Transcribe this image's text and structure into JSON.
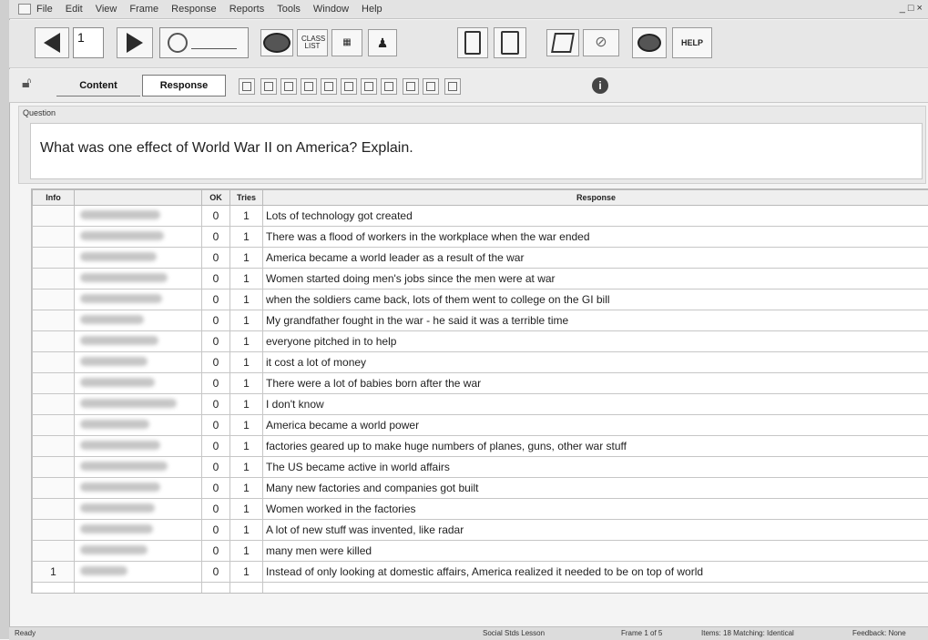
{
  "menu": {
    "items": [
      "File",
      "Edit",
      "View",
      "Frame",
      "Response",
      "Reports",
      "Tools",
      "Window",
      "Help"
    ]
  },
  "toolbar": {
    "page_number": "1",
    "class_list_label": "CLASS LIST",
    "help_label": "HELP"
  },
  "tabs": {
    "content_label": "Content",
    "response_label": "Response"
  },
  "question": {
    "label": "Question",
    "text": "What was one effect of World War II on America? Explain."
  },
  "table": {
    "headers": {
      "info": "Info",
      "name": "",
      "ok": "OK",
      "tries": "Tries",
      "response": "Response"
    },
    "rows": [
      {
        "info": "",
        "ok": "0",
        "tries": "1",
        "response": "Lots of technology got created"
      },
      {
        "info": "",
        "ok": "0",
        "tries": "1",
        "response": "There was a flood of workers in the workplace when the war ended"
      },
      {
        "info": "",
        "ok": "0",
        "tries": "1",
        "response": "America became a world leader as a result of the war"
      },
      {
        "info": "",
        "ok": "0",
        "tries": "1",
        "response": "Women started doing men's jobs since the men were at war"
      },
      {
        "info": "",
        "ok": "0",
        "tries": "1",
        "response": "when the soldiers came back, lots of them went to college on the GI bill"
      },
      {
        "info": "",
        "ok": "0",
        "tries": "1",
        "response": "My grandfather fought in the war - he said it was a terrible time"
      },
      {
        "info": "",
        "ok": "0",
        "tries": "1",
        "response": "everyone pitched in to help"
      },
      {
        "info": "",
        "ok": "0",
        "tries": "1",
        "response": "it cost a lot of money"
      },
      {
        "info": "",
        "ok": "0",
        "tries": "1",
        "response": "There were a lot of babies born after the war"
      },
      {
        "info": "",
        "ok": "0",
        "tries": "1",
        "response": "I don't know"
      },
      {
        "info": "",
        "ok": "0",
        "tries": "1",
        "response": "America became a world power"
      },
      {
        "info": "",
        "ok": "0",
        "tries": "1",
        "response": "factories geared up to make huge numbers of planes, guns, other war stuff"
      },
      {
        "info": "",
        "ok": "0",
        "tries": "1",
        "response": "The US became active in world affairs"
      },
      {
        "info": "",
        "ok": "0",
        "tries": "1",
        "response": "Many new factories and companies got built"
      },
      {
        "info": "",
        "ok": "0",
        "tries": "1",
        "response": "Women worked in the factories"
      },
      {
        "info": "",
        "ok": "0",
        "tries": "1",
        "response": "A lot of new stuff was invented, like radar"
      },
      {
        "info": "",
        "ok": "0",
        "tries": "1",
        "response": "many men were killed"
      },
      {
        "info": "1",
        "ok": "0",
        "tries": "1",
        "response": "Instead of only looking at domestic affairs, America realized it needed to be on top of world"
      }
    ]
  },
  "status": {
    "left": "Ready",
    "class": "Social Stds Lesson",
    "frame": "Frame 1 of 5",
    "matching": "Items: 18  Matching: Identical",
    "feedback": "Feedback: None"
  }
}
